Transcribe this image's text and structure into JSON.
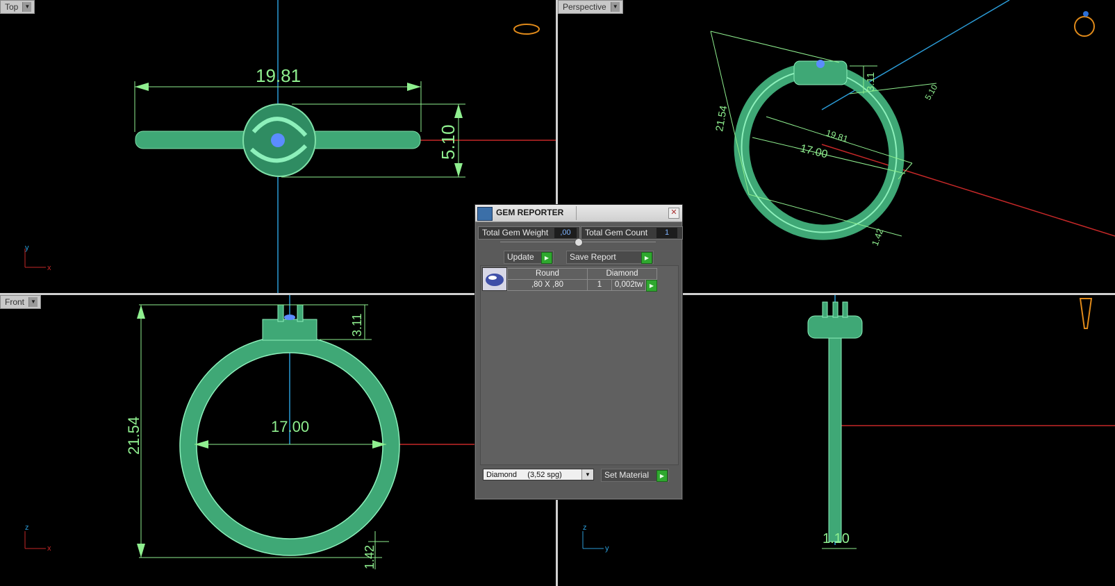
{
  "viewports": {
    "top": {
      "label": "Top",
      "dims": {
        "width": "19.81",
        "height": "5.10"
      },
      "axes": {
        "a": "y",
        "b": "x"
      }
    },
    "perspective": {
      "label": "Perspective",
      "dims": {
        "outer": "21.54",
        "top": "3.11",
        "setting": "5.10",
        "width": "19.81",
        "inner": "17.00",
        "band": "1.42"
      }
    },
    "front": {
      "label": "Front",
      "dims": {
        "outer": "21.54",
        "top": "3.11",
        "inner": "17.00",
        "band": "1.42"
      },
      "axes": {
        "a": "z",
        "b": "x"
      }
    },
    "right": {
      "dims": {
        "band": "1.10"
      },
      "axes": {
        "a": "z",
        "b": "y"
      }
    }
  },
  "gem_reporter": {
    "title": "GEM REPORTER",
    "total_weight_label": "Total Gem Weight",
    "total_weight_value": ",00",
    "total_count_label": "Total Gem Count",
    "total_count_value": "1",
    "update_label": "Update",
    "save_report_label": "Save Report",
    "columns": [
      "Round",
      "Diamond"
    ],
    "row": {
      "size": ",80 X ,80",
      "count": "1",
      "weight": "0,002tw"
    },
    "material_select": "Diamond     (3,52 spg)",
    "set_material_label": "Set Material"
  },
  "colors": {
    "ring": "#3fa876",
    "dimension": "#8fef8f",
    "axis_x": "#c62828",
    "axis_y": "#2b9bd6",
    "gem": "#5b8cff"
  }
}
